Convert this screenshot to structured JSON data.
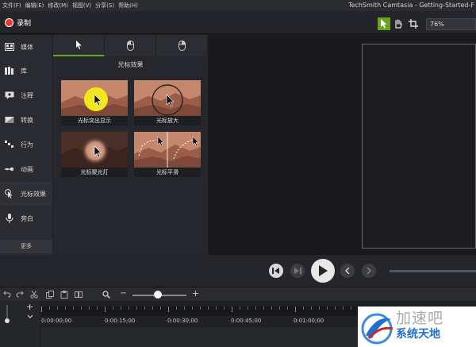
{
  "menu": [
    "文件(F)",
    "编辑(E)",
    "修改(M)",
    "视图(V)",
    "分享(S)",
    "帮助(H)"
  ],
  "app_title": "TechSmith Camtasia - Getting-Started-F",
  "toolbar": {
    "record_label": "录制",
    "zoom_value": "76%",
    "accent_color": "#6aa31f",
    "record_color": "#e53935"
  },
  "sidebar": {
    "items": [
      {
        "label": "媒体",
        "icon": "media-icon"
      },
      {
        "label": "库",
        "icon": "library-icon"
      },
      {
        "label": "注释",
        "icon": "annotation-icon"
      },
      {
        "label": "转换",
        "icon": "transition-icon"
      },
      {
        "label": "行为",
        "icon": "behavior-icon"
      },
      {
        "label": "动画",
        "icon": "animation-icon"
      },
      {
        "label": "光标效果",
        "icon": "cursor-effects-icon"
      },
      {
        "label": "旁白",
        "icon": "microphone-icon"
      }
    ],
    "selected": "光标效果",
    "more_label": "更多"
  },
  "panel": {
    "tabs": [
      {
        "icon": "cursor-arrow-icon",
        "active": true
      },
      {
        "icon": "mouse-left-click-icon",
        "active": false
      },
      {
        "icon": "mouse-right-click-icon",
        "active": false
      }
    ],
    "header": "光标效果",
    "effects": [
      {
        "label": "光标突出显示"
      },
      {
        "label": "光标放大"
      },
      {
        "label": "光标聚光灯"
      },
      {
        "label": "光标平滑"
      }
    ]
  },
  "playback": {
    "buttons": [
      "step-back-icon",
      "prev-clip-icon",
      "play-icon",
      "prev-frame-icon",
      "next-frame-icon"
    ]
  },
  "timeline": {
    "tools": [
      "undo-icon",
      "redo-icon",
      "cut-icon",
      "copy-icon",
      "paste-icon",
      "split-icon",
      "zoom-search-icon"
    ],
    "zoom_minus": "−",
    "zoom_plus": "+",
    "zoom_level": 0.5,
    "add_track": "+",
    "time_labels": [
      "0:00:00;00",
      "0:00:15;00",
      "0:00:30;00",
      "0:00:45;00",
      "0:01:00;00"
    ]
  },
  "watermark": {
    "top_text": "加速吧",
    "main_text": "系统天地"
  }
}
